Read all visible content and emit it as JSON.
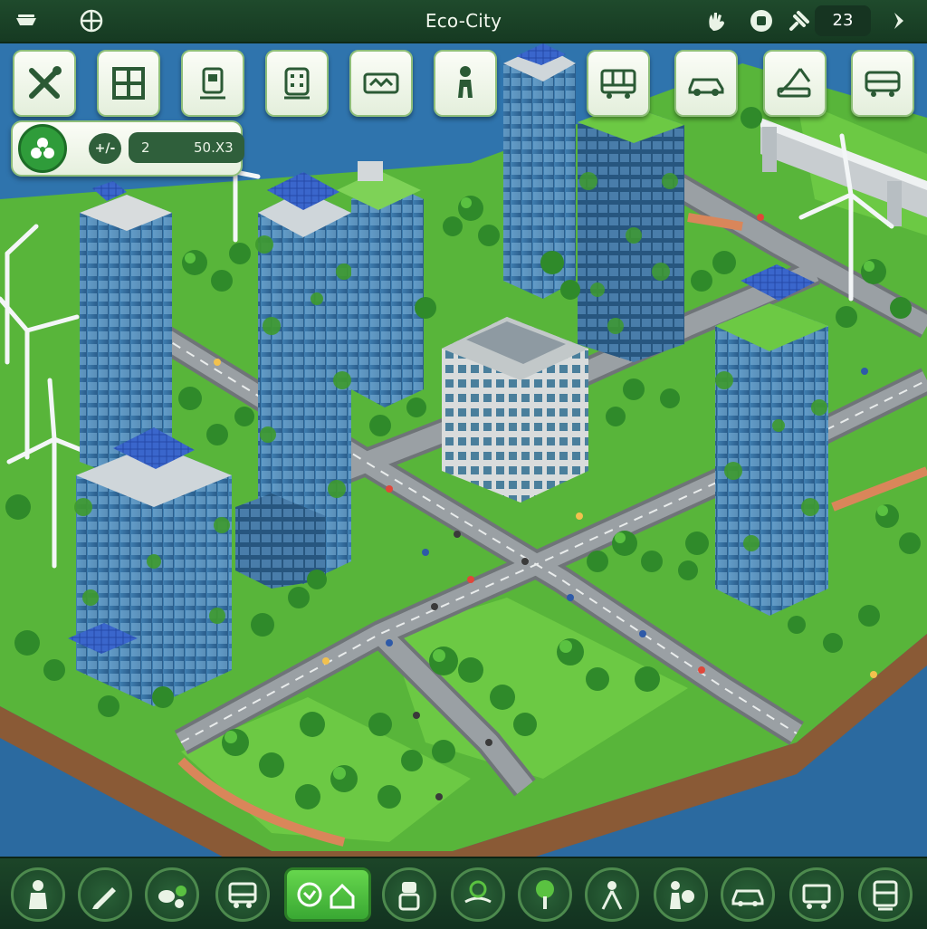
{
  "app": {
    "title": "Eco-City"
  },
  "header": {
    "left_icons": [
      "hand-icon",
      "crosshair-icon"
    ],
    "right_icons": [
      "hand-wave-icon",
      "stop-icon",
      "satellite-icon"
    ],
    "counter": "23"
  },
  "stats": {
    "icon": "leaf-icon",
    "button_icon": "arrows-icon",
    "value_1": "2",
    "value_2": "50.X3"
  },
  "toolbar": {
    "tools": [
      {
        "name": "tools-icon"
      },
      {
        "name": "grid-icon"
      },
      {
        "name": "building-icon"
      },
      {
        "name": "panel-icon"
      },
      {
        "name": "map-icon"
      },
      {
        "name": "person-icon"
      },
      {
        "name": "solar-tower-icon"
      },
      {
        "name": "bus-icon"
      },
      {
        "name": "car-icon"
      },
      {
        "name": "crane-icon"
      },
      {
        "name": "truck-icon"
      }
    ]
  },
  "bottom_tools": [
    {
      "name": "worker-icon"
    },
    {
      "name": "pen-icon"
    },
    {
      "name": "recycle-icon"
    },
    {
      "name": "bus-icon"
    },
    {
      "name": "eco-house-icon",
      "active": true
    },
    {
      "name": "robot-icon"
    },
    {
      "name": "hand-plant-icon"
    },
    {
      "name": "tree-icon"
    },
    {
      "name": "compass-icon"
    },
    {
      "name": "people-icon"
    },
    {
      "name": "car-icon"
    },
    {
      "name": "cart-icon"
    },
    {
      "name": "tram-icon"
    }
  ],
  "colors": {
    "accent_green": "#39a833",
    "bar_green": "#1c4528",
    "water": "#2f74ad"
  }
}
